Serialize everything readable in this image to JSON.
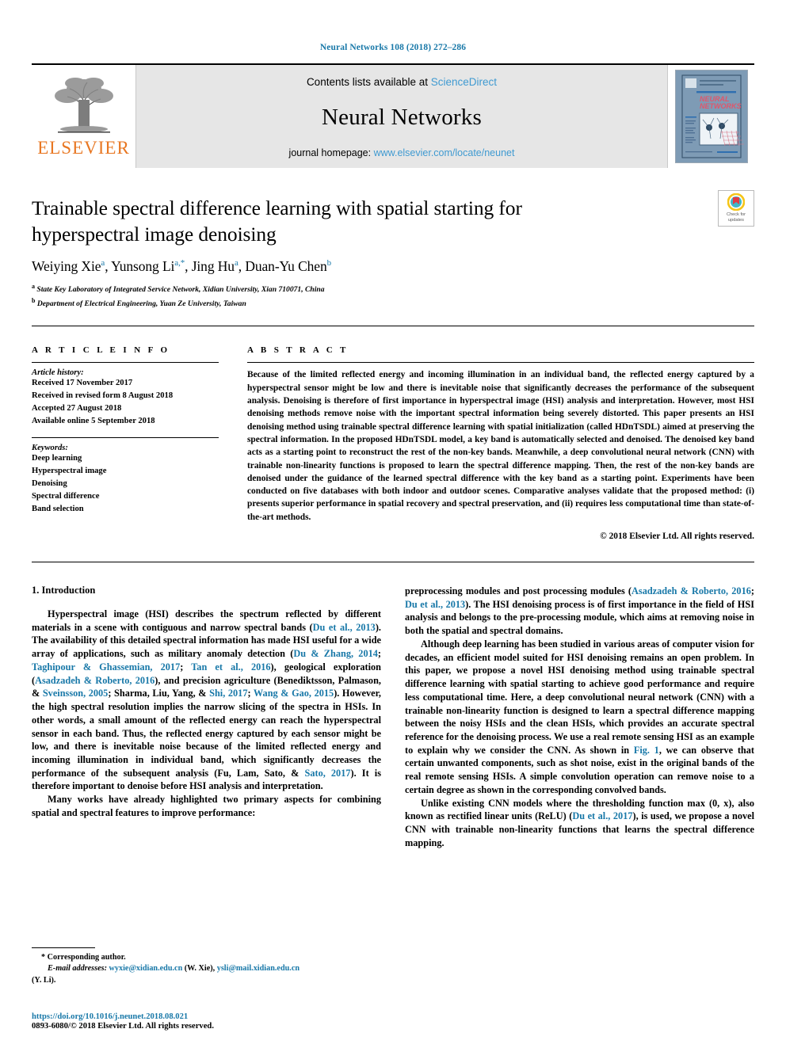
{
  "running_head": "Neural Networks 108 (2018) 272–286",
  "masthead": {
    "publisher_logo_name": "elsevier-tree-logo",
    "publisher_wordmark": "ELSEVIER",
    "contents_prefix": "Contents lists available at ",
    "contents_link": "ScienceDirect",
    "journal_name": "Neural Networks",
    "homepage_prefix": "journal homepage: ",
    "homepage_url": "www.elsevier.com/locate/neunet",
    "cover_title_line1": "NEURAL",
    "cover_title_line2": "NETWORKS"
  },
  "article": {
    "title": "Trainable spectral difference learning with spatial starting for hyperspectral image denoising",
    "authors": [
      {
        "name": "Weiying Xie",
        "marks": "a"
      },
      {
        "name": "Yunsong Li",
        "marks": "a,*"
      },
      {
        "name": "Jing Hu",
        "marks": "a"
      },
      {
        "name": "Duan-Yu Chen",
        "marks": "b"
      }
    ],
    "affiliations": [
      {
        "mark": "a",
        "text": "State Key Laboratory of Integrated Service Network, Xidian University, Xian 710071, China"
      },
      {
        "mark": "b",
        "text": "Department of Electrical Engineering, Yuan Ze University, Taiwan"
      }
    ],
    "crossmark_line1": "Check for",
    "crossmark_line2": "updates"
  },
  "article_info": {
    "heading": "A R T I C L E   I N F O",
    "history_label": "Article history:",
    "history": [
      "Received 17 November 2017",
      "Received in revised form 8 August 2018",
      "Accepted 27 August 2018",
      "Available online 5 September 2018"
    ],
    "keywords_label": "Keywords:",
    "keywords": [
      "Deep learning",
      "Hyperspectral image",
      "Denoising",
      "Spectral difference",
      "Band selection"
    ]
  },
  "abstract": {
    "heading": "A B S T R A C T",
    "text": "Because of the limited reflected energy and incoming illumination in an individual band, the reflected energy captured by a hyperspectral sensor might be low and there is inevitable noise that significantly decreases the performance of the subsequent analysis. Denoising is therefore of first importance in hyperspectral image (HSI) analysis and interpretation. However, most HSI denoising methods remove noise with the important spectral information being severely distorted. This paper presents an HSI denoising method using trainable spectral difference learning with spatial initialization (called HDnTSDL) aimed at preserving the spectral information. In the proposed HDnTSDL model, a key band is automatically selected and denoised. The denoised key band acts as a starting point to reconstruct the rest of the non-key bands. Meanwhile, a deep convolutional neural network (CNN) with trainable non-linearity functions is proposed to learn the spectral difference mapping. Then, the rest of the non-key bands are denoised under the guidance of the learned spectral difference with the key band as a starting point. Experiments have been conducted on five databases with both indoor and outdoor scenes. Comparative analyses validate that the proposed method: (i) presents superior performance in spatial recovery and spectral preservation, and (ii) requires less computational time than state-of-the-art methods.",
    "copyright": "© 2018 Elsevier Ltd. All rights reserved."
  },
  "body": {
    "section_heading": "1. Introduction",
    "left_paragraphs": [
      "Hyperspectral image (HSI) describes the spectrum reflected by different materials in a scene with contiguous and narrow spectral bands (Du et al., 2013). The availability of this detailed spectral information has made HSI useful for a wide array of applications, such as military anomaly detection (Du & Zhang, 2014; Taghipour & Ghassemian, 2017; Tan et al., 2016), geological exploration (Asadzadeh & Roberto, 2016), and precision agriculture (Benediktsson, Palmason, & Sveinsson, 2005; Sharma, Liu, Yang, & Shi, 2017; Wang & Gao, 2015). However, the high spectral resolution implies the narrow slicing of the spectra in HSIs. In other words, a small amount of the reflected energy can reach the hyperspectral sensor in each band. Thus, the reflected energy captured by each sensor might be low, and there is inevitable noise because of the limited reflected energy and incoming illumination in individual band, which significantly decreases the performance of the subsequent analysis (Fu, Lam, Sato, & Sato, 2017). It is therefore important to denoise before HSI analysis and interpretation.",
      "Many works have already highlighted two primary aspects for combining spatial and spectral features to improve performance:"
    ],
    "right_paragraphs": [
      "preprocessing modules and post processing modules (Asadzadeh & Roberto, 2016; Du et al., 2013). The HSI denoising process is of first importance in the field of HSI analysis and belongs to the pre-processing module, which aims at removing noise in both the spatial and spectral domains.",
      "Although deep learning has been studied in various areas of computer vision for decades, an efficient model suited for HSI denoising remains an open problem. In this paper, we propose a novel HSI denoising method using trainable spectral difference learning with spatial starting to achieve good performance and require less computational time. Here, a deep convolutional neural network (CNN) with a trainable non-linearity function is designed to learn a spectral difference mapping between the noisy HSIs and the clean HSIs, which provides an accurate spectral reference for the denoising process. We use a real remote sensing HSI as an example to explain why we consider the CNN. As shown in Fig. 1, we can observe that certain unwanted components, such as shot noise, exist in the original bands of the real remote sensing HSIs. A simple convolution operation can remove noise to a certain degree as shown in the corresponding convolved bands.",
      "Unlike existing CNN models where the thresholding function max (0, x), also known as rectified linear units (ReLU) (Du et al., 2017), is used, we propose a novel CNN with trainable non-linearity functions that learns the spectral difference mapping."
    ]
  },
  "footnote": {
    "corresponding": "* Corresponding author.",
    "email_label": "E-mail addresses:",
    "email1": "wyxie@xidian.edu.cn",
    "email1_owner": "(W. Xie),",
    "email2": "ysli@mail.xidian.edu.cn",
    "email2_owner": "(Y. Li)."
  },
  "imprint": {
    "doi": "https://doi.org/10.1016/j.neunet.2018.08.021",
    "issn_line": "0893-6080/© 2018 Elsevier Ltd. All rights reserved."
  },
  "colors": {
    "link": "#1878a8",
    "masthead_link": "#3f9ad1",
    "elsevier_orange": "#e87722",
    "masthead_bg": "#e6e6e6"
  }
}
